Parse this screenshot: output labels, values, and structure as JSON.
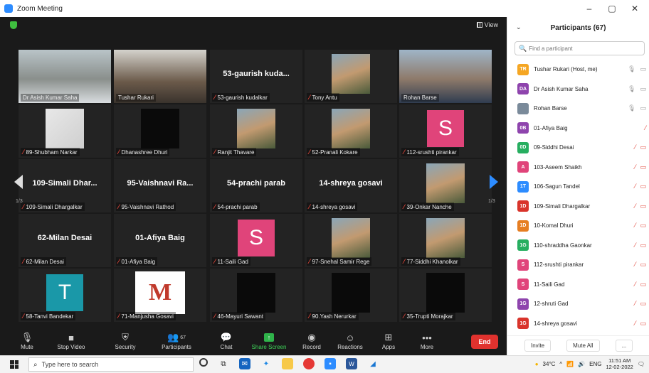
{
  "window": {
    "title": "Zoom Meeting",
    "minimize": "–",
    "maximize": "▢",
    "close": "✕"
  },
  "view_label": "View",
  "tiles": [
    {
      "label": "Dr Asish Kumar Saha",
      "center": "",
      "kind": "video",
      "muted": false,
      "active": true
    },
    {
      "label": "Tushar Rukari",
      "center": "",
      "kind": "video",
      "muted": false,
      "active": false
    },
    {
      "label": "53-gaurish kudalkar",
      "center": "53-gaurish  kuda...",
      "kind": "name",
      "muted": true,
      "active": false
    },
    {
      "label": "Tony Antu",
      "center": "",
      "kind": "photo",
      "muted": true,
      "active": false
    },
    {
      "label": "Rohan Barse",
      "center": "",
      "kind": "video",
      "muted": false,
      "active": false
    },
    {
      "label": "89-Shubham Narkar",
      "center": "",
      "kind": "blur",
      "muted": true,
      "active": false
    },
    {
      "label": "Dhanashree Dhuri",
      "center": "",
      "kind": "dark",
      "muted": true,
      "active": false
    },
    {
      "label": "Ranjit Thavare",
      "center": "",
      "kind": "photo",
      "muted": true,
      "active": false
    },
    {
      "label": "52-Pranali Kokare",
      "center": "",
      "kind": "photo",
      "muted": true,
      "active": false
    },
    {
      "label": "112-srushti pirankar",
      "center": "S",
      "kind": "letter",
      "color": "#e0447a",
      "muted": true,
      "active": false
    },
    {
      "label": "109-Simali Dhargalkar",
      "center": "109-Simali  Dhar...",
      "kind": "name",
      "muted": true,
      "active": false
    },
    {
      "label": "95-Vaishnavi Rathod",
      "center": "95-Vaishnavi  Ra...",
      "kind": "name",
      "muted": true,
      "active": false
    },
    {
      "label": "54-prachi parab",
      "center": "54-prachi parab",
      "kind": "name",
      "muted": true,
      "active": false
    },
    {
      "label": "14-shreya gosavi",
      "center": "14-shreya gosavi",
      "kind": "name",
      "muted": true,
      "active": false
    },
    {
      "label": "39-Onkar Nanche",
      "center": "",
      "kind": "photo",
      "muted": true,
      "active": false
    },
    {
      "label": "62-Milan Desai",
      "center": "62-Milan Desai",
      "kind": "name",
      "muted": true,
      "active": false
    },
    {
      "label": "01-Afiya Baig",
      "center": "01-Afiya Baig",
      "kind": "name",
      "muted": true,
      "active": false
    },
    {
      "label": "11-Saili Gad",
      "center": "S",
      "kind": "letter",
      "color": "#e0447a",
      "muted": true,
      "active": false
    },
    {
      "label": "97-Snehal Samir Rege",
      "center": "",
      "kind": "photo",
      "muted": true,
      "active": false
    },
    {
      "label": "77-Siddhi Khanolkar",
      "center": "",
      "kind": "photo",
      "muted": true,
      "active": false
    },
    {
      "label": "58-Tanvi Bandekar",
      "center": "T",
      "kind": "letter",
      "color": "#1a98a8",
      "muted": true,
      "active": false
    },
    {
      "label": "71-Manjusha Gosavi",
      "center": "M",
      "kind": "logo",
      "muted": true,
      "active": false
    },
    {
      "label": "46-Mayuri Sawant",
      "center": "",
      "kind": "dark",
      "muted": true,
      "active": false
    },
    {
      "label": "90.Yash Nerurkar",
      "center": "",
      "kind": "dark",
      "muted": true,
      "active": false
    },
    {
      "label": "35-Trupti Morajkar",
      "center": "",
      "kind": "dark",
      "muted": true,
      "active": false
    }
  ],
  "pages": {
    "left": "1/3",
    "right": "1/3"
  },
  "toolbar": {
    "mute": "Mute",
    "stop_video": "Stop Video",
    "security": "Security",
    "participants": "Participants",
    "participants_count": "67",
    "chat": "Chat",
    "share_screen": "Share Screen",
    "record": "Record",
    "reactions": "Reactions",
    "apps": "Apps",
    "more": "More",
    "end": "End"
  },
  "panel": {
    "title": "Participants (67)",
    "search_placeholder": "Find a participant",
    "invite": "Invite",
    "mute_all": "Mute All",
    "more": "...",
    "participants": [
      {
        "initials": "TR",
        "name": "Tushar Rukari (Host, me)",
        "color": "#f5a623",
        "mic_red": false,
        "vid_red": false
      },
      {
        "initials": "DA",
        "name": "Dr Asish Kumar Saha",
        "color": "#8e44ad",
        "mic_red": false,
        "vid_red": false
      },
      {
        "initials": "",
        "name": "Rohan Barse",
        "color": "#7a8a9a",
        "mic_red": false,
        "vid_red": false
      },
      {
        "initials": "0B",
        "name": "01-Afiya Baig",
        "color": "#8e44ad",
        "mic_red": true,
        "vid_red": false,
        "no_vid": true
      },
      {
        "initials": "0D",
        "name": "09-Siddhi Desai",
        "color": "#27ae60",
        "mic_red": true,
        "vid_red": true
      },
      {
        "initials": "A",
        "name": "103-Aseem Shaikh",
        "color": "#e0447a",
        "mic_red": true,
        "vid_red": true
      },
      {
        "initials": "1T",
        "name": "106-Sagun Tandel",
        "color": "#2d8cff",
        "mic_red": true,
        "vid_red": true
      },
      {
        "initials": "1D",
        "name": "109-Simali Dhargalkar",
        "color": "#d9342b",
        "mic_red": true,
        "vid_red": true
      },
      {
        "initials": "1D",
        "name": "10-Komal Dhuri",
        "color": "#e67e22",
        "mic_red": true,
        "vid_red": true
      },
      {
        "initials": "1G",
        "name": "110-shraddha Gaonkar",
        "color": "#27ae60",
        "mic_red": true,
        "vid_red": true
      },
      {
        "initials": "S",
        "name": "112-srushti pirankar",
        "color": "#e0447a",
        "mic_red": true,
        "vid_red": true
      },
      {
        "initials": "S",
        "name": "11-Saili Gad",
        "color": "#e0447a",
        "mic_red": true,
        "vid_red": true
      },
      {
        "initials": "1G",
        "name": "12-shruti Gad",
        "color": "#8e44ad",
        "mic_red": true,
        "vid_red": true
      },
      {
        "initials": "1G",
        "name": "14-shreya gosavi",
        "color": "#d9342b",
        "mic_red": true,
        "vid_red": true
      }
    ]
  },
  "taskbar": {
    "search_placeholder": "Type here to search",
    "temp": "34°C",
    "lang": "ENG",
    "time": "11:51 AM",
    "date": "12-02-2022"
  }
}
